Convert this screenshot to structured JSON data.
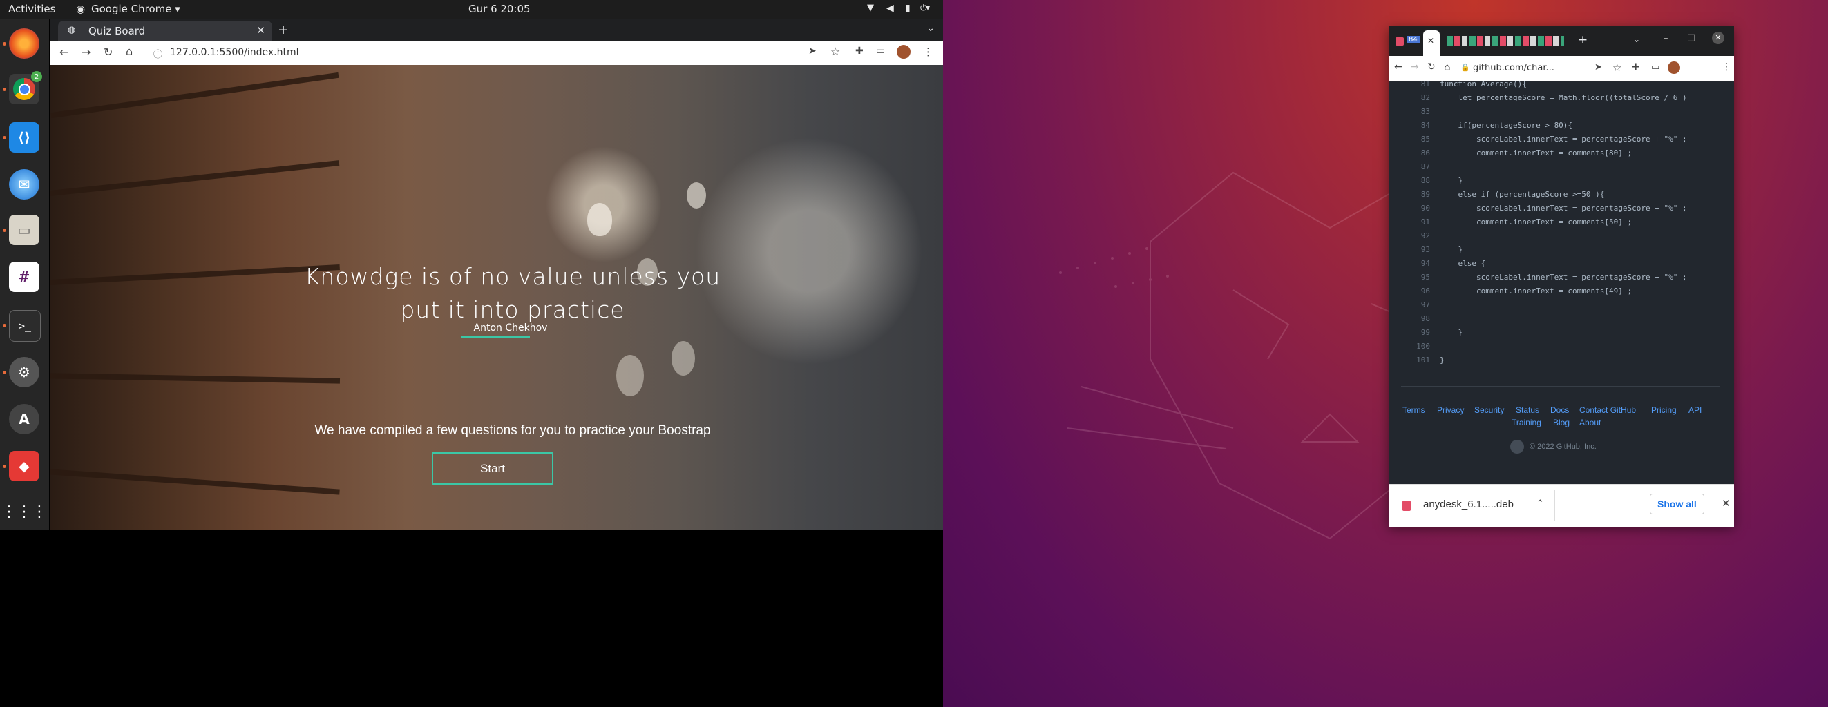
{
  "system": {
    "activities": "Activities",
    "app_menu": "Google Chrome",
    "clock": "Gur 6  20:05"
  },
  "dock": {
    "chrome_badge": "2",
    "icons": [
      "firefox-icon",
      "chrome-icon",
      "vscode-icon",
      "thunderbird-icon",
      "files-icon",
      "slack-icon",
      "terminal-icon",
      "settings-icon",
      "software-icon",
      "anydesk-icon",
      "app-grid-icon"
    ]
  },
  "left_browser": {
    "tab_title": "Quiz Board",
    "url": "127.0.0.1:5500/index.html",
    "page": {
      "quote_line1": "Knowdge is of no value unless you",
      "quote_line2": "put it into practice",
      "author": "Anton Chekhov",
      "subtitle": "We have compiled a few questions for you to practice your Boostrap",
      "start_label": "Start"
    }
  },
  "right_browser": {
    "tab_label": "84",
    "url": "github.com/char...",
    "code_lines": [
      {
        "n": "81",
        "text": "function Average(){"
      },
      {
        "n": "82",
        "text": "    let percentageScore = Math.floor((totalScore / 6 )"
      },
      {
        "n": "83",
        "text": ""
      },
      {
        "n": "84",
        "text": "    if(percentageScore > 80){"
      },
      {
        "n": "85",
        "text": "        scoreLabel.innerText = percentageScore + \"%\" ;"
      },
      {
        "n": "86",
        "text": "        comment.innerText = comments[80] ;"
      },
      {
        "n": "87",
        "text": ""
      },
      {
        "n": "88",
        "text": "    }"
      },
      {
        "n": "89",
        "text": "    else if (percentageScore >=50 ){"
      },
      {
        "n": "90",
        "text": "        scoreLabel.innerText = percentageScore + \"%\" ;"
      },
      {
        "n": "91",
        "text": "        comment.innerText = comments[50] ;"
      },
      {
        "n": "92",
        "text": ""
      },
      {
        "n": "93",
        "text": "    }"
      },
      {
        "n": "94",
        "text": "    else {"
      },
      {
        "n": "95",
        "text": "        scoreLabel.innerText = percentageScore + \"%\" ;"
      },
      {
        "n": "96",
        "text": "        comment.innerText = comments[49] ;"
      },
      {
        "n": "97",
        "text": ""
      },
      {
        "n": "98",
        "text": ""
      },
      {
        "n": "99",
        "text": "    }"
      },
      {
        "n": "100",
        "text": ""
      },
      {
        "n": "101",
        "text": "}"
      }
    ],
    "footer_links": [
      "Terms",
      "Privacy",
      "Security",
      "Status",
      "Docs",
      "Contact GitHub",
      "Pricing",
      "API",
      "Training",
      "Blog",
      "About"
    ],
    "copyright": "© 2022 GitHub, Inc.",
    "download_file": "anydesk_6.1.....deb",
    "show_all": "Show all"
  },
  "colors": {
    "accent_teal": "#3bc7a6",
    "github_link": "#539bf5",
    "code_bg": "#22272e"
  }
}
